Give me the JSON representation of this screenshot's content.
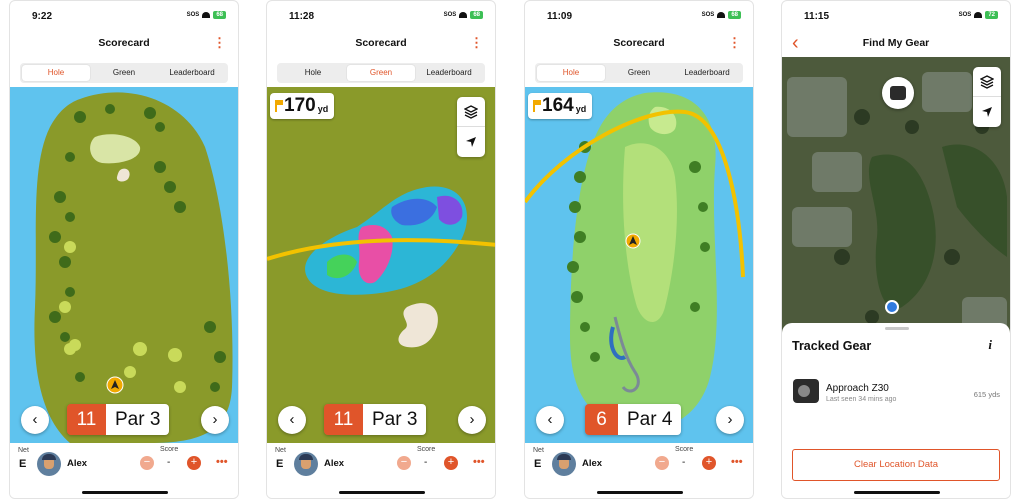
{
  "colors": {
    "accent": "#e0552a",
    "water": "#5fc3ee",
    "rough": "#8a9a2a",
    "fairway": "#8fd16a"
  },
  "shared": {
    "status_sos": "SOS",
    "title": "Scorecard",
    "tabs": [
      "Hole",
      "Green",
      "Leaderboard"
    ],
    "net_label": "Net",
    "net_value": "E",
    "player_name": "Alex",
    "score_label": "Score",
    "score_value": "-",
    "prev_icon": "chevron-left-icon",
    "next_icon": "chevron-right-icon"
  },
  "screen1": {
    "time": "9:22",
    "battery": "68",
    "active_tab": "Hole",
    "hole_number": "11",
    "par_label": "Par 3"
  },
  "screen2": {
    "time": "11:28",
    "battery": "68",
    "active_tab": "Green",
    "hole_number": "11",
    "par_label": "Par 3",
    "yardage": "170",
    "yardage_unit": "yd"
  },
  "screen3": {
    "time": "11:09",
    "battery": "68",
    "active_tab": "Hole",
    "hole_number": "6",
    "par_label": "Par 4",
    "yardage": "164",
    "yardage_unit": "yd"
  },
  "screen4": {
    "time": "11:15",
    "battery": "72",
    "title": "Find My Gear",
    "sheet_title": "Tracked Gear",
    "info_label": "i",
    "gear": {
      "name": "Approach Z30",
      "last_seen": "Last seen 34 mins ago",
      "distance": "615 yds"
    },
    "clear_button": "Clear Location Data"
  }
}
